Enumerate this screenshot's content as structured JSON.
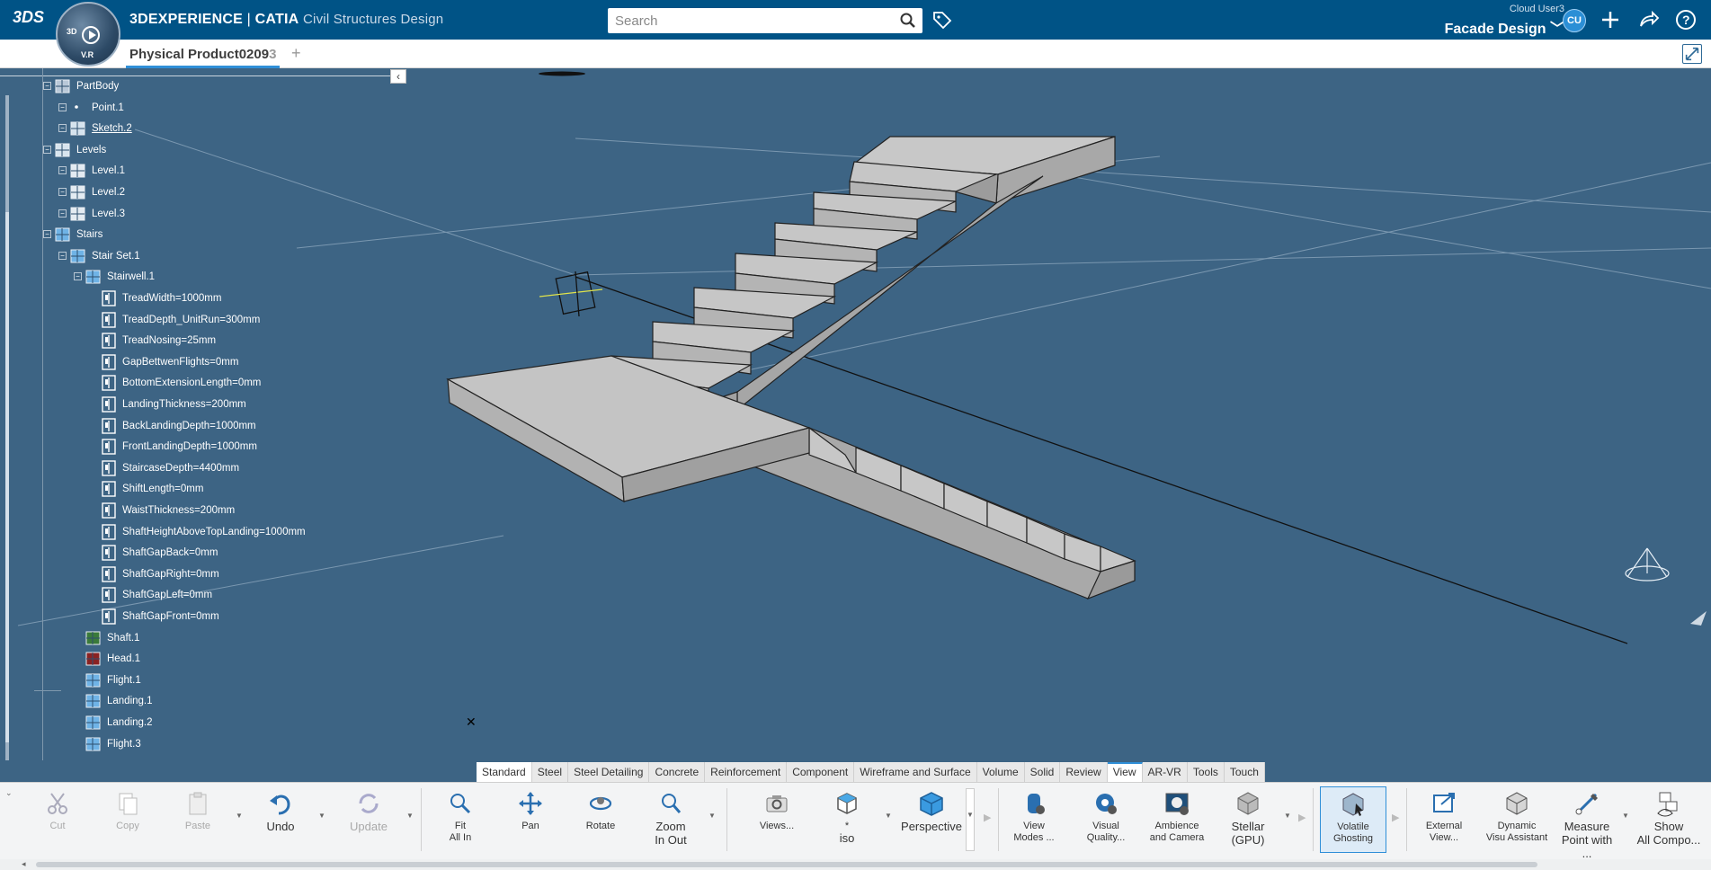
{
  "topbar": {
    "brand": "3DS",
    "compass": {
      "top": "3D",
      "right": "V.R",
      "center": "play"
    },
    "title_strong": "3DEXPERIENCE",
    "title_brand": "CATIA",
    "title_app": "Civil Structures Design",
    "search_placeholder": "Search",
    "user": "Cloud User3",
    "space": "Facade Design",
    "avatar_initials": "CU",
    "accent": "#005386"
  },
  "document": {
    "tab_label_main": "Physical Product0209",
    "tab_label_fade": "3",
    "add_label": "+"
  },
  "tree": {
    "nodes": [
      {
        "label": "PartBody",
        "icon": "partbody-icon"
      },
      {
        "label": "Point.1",
        "icon": "point-icon"
      },
      {
        "label": "Sketch.2",
        "icon": "sketch-icon"
      },
      {
        "label": "Levels",
        "icon": "levels-icon"
      },
      {
        "label": "Level.1",
        "icon": "level-icon"
      },
      {
        "label": "Level.2",
        "icon": "level-icon"
      },
      {
        "label": "Level.3",
        "icon": "level-icon"
      },
      {
        "label": "Stairs",
        "icon": "stairs-icon"
      },
      {
        "label": "Stair Set.1",
        "icon": "stair-set-icon"
      },
      {
        "label": "Stairwell.1",
        "icon": "stairwell-icon"
      },
      {
        "label": "TreadWidth=1000mm",
        "icon": "parameter-icon"
      },
      {
        "label": "TreadDepth_UnitRun=300mm",
        "icon": "parameter-icon"
      },
      {
        "label": "TreadNosing=25mm",
        "icon": "parameter-icon"
      },
      {
        "label": "GapBettwenFlights=0mm",
        "icon": "parameter-icon"
      },
      {
        "label": "BottomExtensionLength=0mm",
        "icon": "parameter-icon"
      },
      {
        "label": "LandingThickness=200mm",
        "icon": "parameter-icon"
      },
      {
        "label": "BackLandingDepth=1000mm",
        "icon": "parameter-icon"
      },
      {
        "label": "FrontLandingDepth=1000mm",
        "icon": "parameter-icon"
      },
      {
        "label": "StaircaseDepth=4400mm",
        "icon": "parameter-icon"
      },
      {
        "label": "ShiftLength=0mm",
        "icon": "parameter-icon"
      },
      {
        "label": "WaistThickness=200mm",
        "icon": "parameter-icon"
      },
      {
        "label": "ShaftHeightAboveTopLanding=1000mm",
        "icon": "parameter-icon"
      },
      {
        "label": "ShaftGapBack=0mm",
        "icon": "parameter-icon"
      },
      {
        "label": "ShaftGapRight=0mm",
        "icon": "parameter-icon"
      },
      {
        "label": "ShaftGapLeft=0mm",
        "icon": "parameter-icon"
      },
      {
        "label": "ShaftGapFront=0mm",
        "icon": "parameter-icon"
      },
      {
        "label": "Shaft.1",
        "icon": "shaft-icon"
      },
      {
        "label": "Head.1",
        "icon": "head-icon"
      },
      {
        "label": "Flight.1",
        "icon": "flight-icon"
      },
      {
        "label": "Landing.1",
        "icon": "landing-icon"
      },
      {
        "label": "Landing.2",
        "icon": "landing-icon"
      },
      {
        "label": "Flight.3",
        "icon": "flight-icon"
      }
    ]
  },
  "workbench_tabs": [
    "Standard",
    "Steel",
    "Steel Detailing",
    "Concrete",
    "Reinforcement",
    "Component",
    "Wireframe and Surface",
    "Volume",
    "Solid",
    "Review",
    "View",
    "AR-VR",
    "Tools",
    "Touch"
  ],
  "active_tab": "View",
  "toolbar": {
    "cut": "Cut",
    "copy": "Copy",
    "paste": "Paste",
    "undo": "Undo",
    "update": "Update",
    "fit_1": "Fit",
    "fit_2": "All In",
    "pan": "Pan",
    "rotate": "Rotate",
    "zoom_1": "Zoom",
    "zoom_2": "In Out",
    "views": "Views...",
    "iso_1": "*",
    "iso_2": "iso",
    "perspective": "Perspective",
    "view_modes_1": "View",
    "view_modes_2": "Modes ...",
    "visual_quality_1": "Visual",
    "visual_quality_2": "Quality...",
    "ambience_1": "Ambience",
    "ambience_2": "and Camera",
    "stellar_1": "Stellar",
    "stellar_2": "(GPU)",
    "ghosting_1": "Volatile",
    "ghosting_2": "Ghosting",
    "external_1": "External",
    "external_2": "View...",
    "dynamic_1": "Dynamic",
    "dynamic_2": "Visu Assistant",
    "measure_1": "Measure",
    "measure_2": "Point with ...",
    "show_1": "Show",
    "show_2": "All Compo..."
  }
}
